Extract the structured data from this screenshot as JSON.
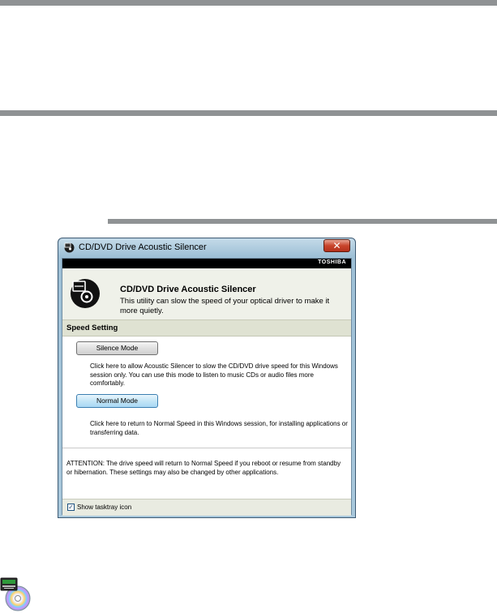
{
  "window": {
    "title": "CD/DVD Drive Acoustic Silencer",
    "close_glyph": "✕",
    "brand": "TOSHIBA",
    "heading": "CD/DVD Drive Acoustic Silencer",
    "description": "This utility can slow  the speed of  your optical driver to make it more quietly."
  },
  "speed_setting": {
    "label": "Speed Setting",
    "silence_button": "Silence Mode",
    "silence_description": "Click here to allow Acoustic Silencer to slow the CD/DVD drive speed for this Windows session only. You can use this mode to listen to music CDs or audio files more comfortably.",
    "normal_button": "Normal Mode",
    "normal_description": "Click here to return to Normal Speed in this Windows session, for installing applications or transferring data."
  },
  "attention": "ATTENTION: The drive speed will return to Normal Speed if you reboot or resume from standby or hibernation. These settings may also be changed by other applications.",
  "footer": {
    "checkbox_checked": true,
    "checkbox_glyph": "✓",
    "checkbox_label": "Show tasktray icon"
  },
  "icons": {
    "app": "disc-icon",
    "tray": "cd-dvd-tray-icon"
  },
  "colors": {
    "rule": "#8f9294",
    "title_bar": "#a9c8dc",
    "close_button": "#c8442b",
    "brand_bar": "#000000"
  }
}
